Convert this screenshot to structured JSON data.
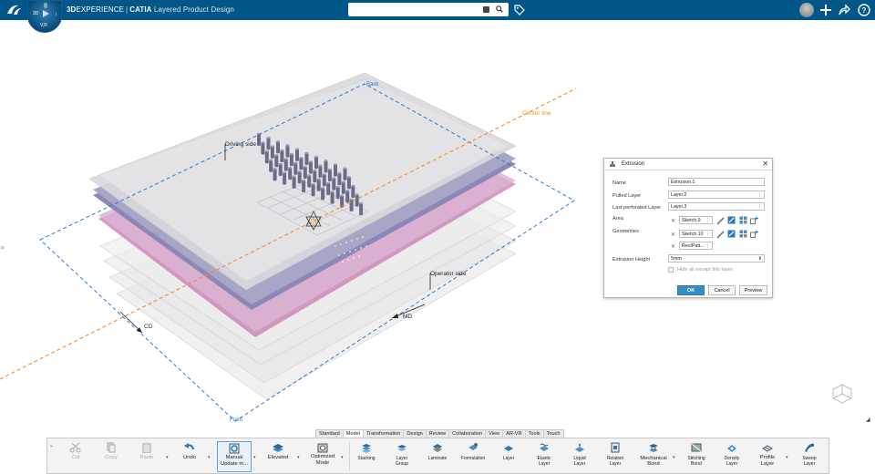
{
  "app": {
    "brand_prefix": "3D",
    "brand_main": "EXPERIENCE",
    "brand_sep": "|",
    "brand_catia": "CATIA",
    "brand_app": "Layered Product Design",
    "compass_left": "3D",
    "compass_version": "V,R"
  },
  "search": {
    "value": "",
    "placeholder": ""
  },
  "viewport": {
    "labels": {
      "back": "Back",
      "front": "Front",
      "driving_side": "Driving side",
      "operator_side": "Operator side",
      "center_line": "Center line",
      "cd": "CD",
      "md": "MD"
    },
    "colors": {
      "center_line": "#f0902c",
      "dashed_boundary": "#2e7ad1",
      "layer_purple": "#8c88b5",
      "layer_pink": "#c97bb2"
    }
  },
  "dialog": {
    "title": "Extrusion",
    "name_label": "Name",
    "name_value": "Extrusion.1",
    "pulled_layer_label": "Pulled Layer",
    "pulled_layer_value": "Layer.2",
    "last_perforated_label": "Last perforated Layer",
    "last_perforated_value": "Layer.3",
    "area_label": "Area",
    "area_value": "Sketch.9",
    "geometries_label": "Geometries",
    "geometries_values": [
      "Sketch.10",
      "RectPatt..."
    ],
    "extrusion_height_label": "Extrusion Height",
    "extrusion_height_value": "5mm",
    "hide_label": "Hide all except this layer",
    "ok": "OK",
    "cancel": "Cancel",
    "preview": "Preview"
  },
  "tabs": [
    "Standard",
    "Model",
    "Transformation",
    "Design",
    "Review",
    "Collaboration",
    "View",
    "AR-VR",
    "Tools",
    "Touch"
  ],
  "active_tab": "Model",
  "ribbon": {
    "cut": "Cut",
    "copy": "Copy",
    "paste": "Paste",
    "undo": "Undo",
    "manual_update_1": "Manual",
    "manual_update_2": "Update m...",
    "elevated": "Elevated",
    "optimized_1": "Optimized",
    "optimized_2": "Mode",
    "stacking": "Stacking",
    "layer_group_1": "Layer",
    "layer_group_2": "Group",
    "laminate": "Laminate",
    "formulation": "Formulation",
    "layer": "Layer",
    "elastic_1": "Elastic",
    "elastic_2": "Layer",
    "liquid_1": "Liquid",
    "liquid_2": "Layer",
    "relation_1": "Relation",
    "relation_2": "Layer",
    "mech_bond_1": "Mechanical",
    "mech_bond_2": "Bond",
    "stitching_1": "Stitching",
    "stitching_2": "Bond",
    "density_1": "Density",
    "density_2": "Layer",
    "profile_1": "Profile",
    "profile_2": "Layer",
    "sweep_1": "Sweep",
    "sweep_2": "Layer"
  }
}
